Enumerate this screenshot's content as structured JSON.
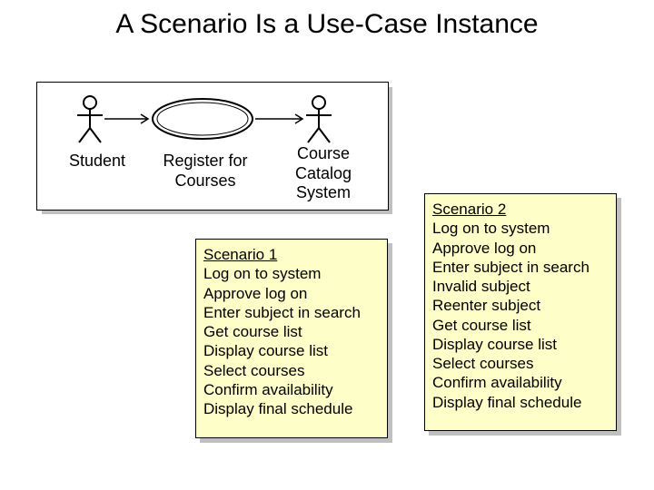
{
  "title": "A Scenario Is a Use-Case Instance",
  "diagram": {
    "actor_left": "Student",
    "usecase": "Register for\nCourses",
    "actor_right": "Course\nCatalog\nSystem"
  },
  "scenario1": {
    "heading": "Scenario 1",
    "steps": [
      "Log on to system",
      "Approve log on",
      "Enter subject in search",
      "Get course list",
      "Display course list",
      "Select courses",
      "Confirm availability",
      "Display final schedule"
    ]
  },
  "scenario2": {
    "heading": "Scenario 2",
    "steps": [
      "Log on to system",
      "Approve log on",
      "Enter subject in search",
      "Invalid subject",
      "Reenter subject",
      "Get course list",
      "Display course list",
      "Select courses",
      "Confirm availability",
      "Display final schedule"
    ]
  }
}
